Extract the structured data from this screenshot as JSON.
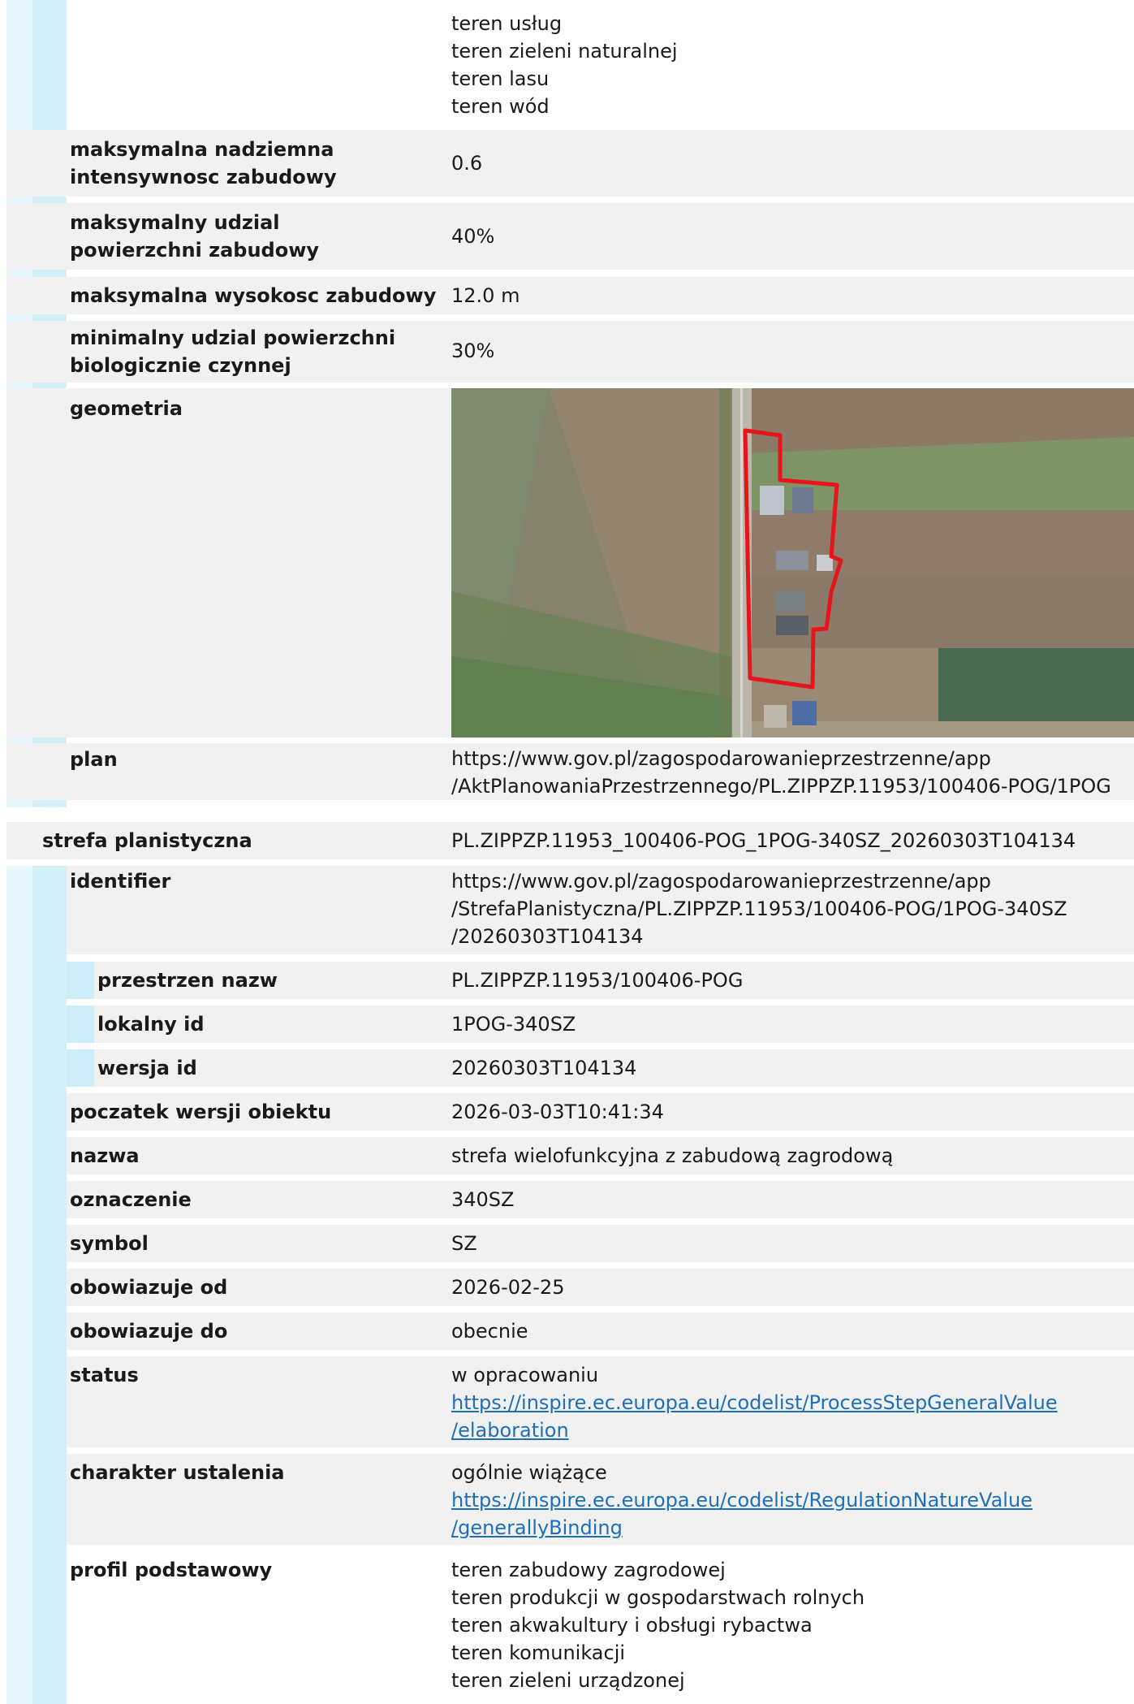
{
  "block1": {
    "profile_continuation": [
      "teren usług",
      "teren zieleni naturalnej",
      "teren lasu",
      "teren wód"
    ],
    "rows": [
      {
        "label": "maksymalna nadziemna intensywnosc zabudowy",
        "value": "0.6"
      },
      {
        "label": "maksymalny udzial powierzchni zabudowy",
        "value": "40%"
      },
      {
        "label": "maksymalna wysokosc zabudowy",
        "value": "12.0 m"
      },
      {
        "label": "minimalny udzial powierzchni biologicznie czynnej",
        "value": "30%"
      }
    ],
    "geometry_label": "geometria",
    "plan_label": "plan",
    "plan_url": "https://www.gov.pl/zagospodarowanieprzestrzenne/app\n/AktPlanowaniaPrzestrzennego/PL.ZIPPZP.11953/100406-POG/1POG"
  },
  "block2": {
    "title_label": "strefa planistyczna",
    "title_value": "PL.ZIPPZP.11953_100406-POG_1POG-340SZ_20260303T104134",
    "identifier_label": "identifier",
    "identifier_value": "https://www.gov.pl/zagospodarowanieprzestrzenne/app\n/StrefaPlanistyczna/PL.ZIPPZP.11953/100406-POG/1POG-340SZ\n/20260303T104134",
    "sub": [
      {
        "label": "przestrzen nazw",
        "value": "PL.ZIPPZP.11953/100406-POG"
      },
      {
        "label": "lokalny id",
        "value": "1POG-340SZ"
      },
      {
        "label": "wersja id",
        "value": "20260303T104134"
      }
    ],
    "rows": [
      {
        "label": "poczatek wersji obiektu",
        "value": "2026-03-03T10:41:34"
      },
      {
        "label": "nazwa",
        "value": "strefa wielofunkcyjna z zabudową zagrodową"
      },
      {
        "label": "oznaczenie",
        "value": "340SZ"
      },
      {
        "label": "symbol",
        "value": "SZ"
      },
      {
        "label": "obowiazuje od",
        "value": "2026-02-25"
      },
      {
        "label": "obowiazuje do",
        "value": "obecnie"
      }
    ],
    "status": {
      "label": "status",
      "text": "w opracowaniu",
      "link": "https://inspire.ec.europa.eu/codelist/ProcessStepGeneralValue\n/elaboration"
    },
    "charakter": {
      "label": "charakter ustalenia",
      "text": "ogólnie wiążące",
      "link": "https://inspire.ec.europa.eu/codelist/RegulationNatureValue\n/generallyBinding"
    },
    "profil": {
      "label": "profil podstawowy",
      "items": [
        "teren zabudowy zagrodowej",
        "teren produkcji w gospodarstwach rolnych",
        "teren akwakultury i obsługi rybactwa",
        "teren komunikacji",
        "teren zieleni urządzonej"
      ]
    }
  },
  "colors": {
    "stripe": "#e6f6fb",
    "bar": "#d3eff8",
    "row": "#f1f1f1",
    "link": "#1f6fb8",
    "polygon": "#e8141b"
  }
}
